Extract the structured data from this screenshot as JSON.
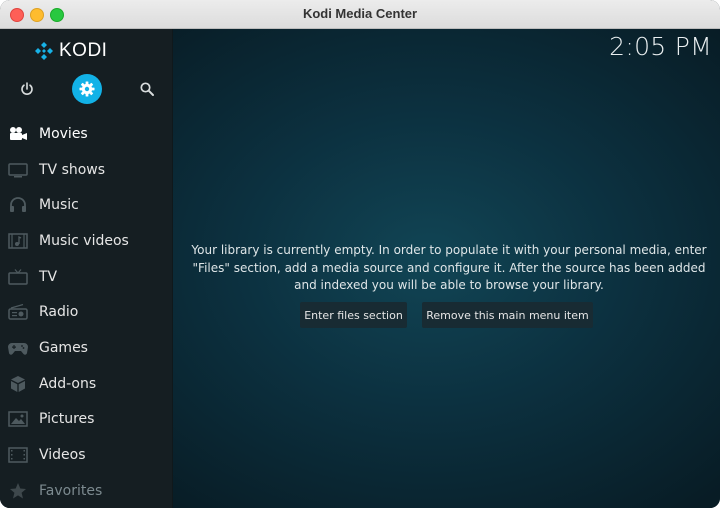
{
  "window": {
    "title": "Kodi Media Center"
  },
  "sidebar": {
    "logo_text": "KODI",
    "top_icons": [
      {
        "name": "power-icon"
      },
      {
        "name": "settings-icon",
        "active": true,
        "color": "#12b2e7"
      },
      {
        "name": "search-icon"
      }
    ],
    "items": [
      {
        "label": "Movies",
        "icon": "movie-camera-icon",
        "active": true
      },
      {
        "label": "TV shows",
        "icon": "tv-monitor-icon"
      },
      {
        "label": "Music",
        "icon": "headphones-icon"
      },
      {
        "label": "Music videos",
        "icon": "music-video-icon"
      },
      {
        "label": "TV",
        "icon": "tv-icon"
      },
      {
        "label": "Radio",
        "icon": "radio-icon"
      },
      {
        "label": "Games",
        "icon": "gamepad-icon"
      },
      {
        "label": "Add-ons",
        "icon": "addons-box-icon"
      },
      {
        "label": "Pictures",
        "icon": "picture-icon"
      },
      {
        "label": "Videos",
        "icon": "film-strip-icon"
      },
      {
        "label": "Favorites",
        "icon": "star-icon",
        "dimmed": true
      }
    ]
  },
  "clock": "2:05 PM",
  "main": {
    "message": "Your library is currently empty. In order to populate it with your personal media, enter \"Files\" section, add a media source and configure it. After the source has been added and indexed you will be able to browse your library.",
    "buttons": {
      "enter_files": "Enter files section",
      "remove_item": "Remove this main menu item"
    }
  },
  "colors": {
    "accent": "#12b2e7",
    "sidebar_bg": "#151e22",
    "background": "#0c3140"
  }
}
